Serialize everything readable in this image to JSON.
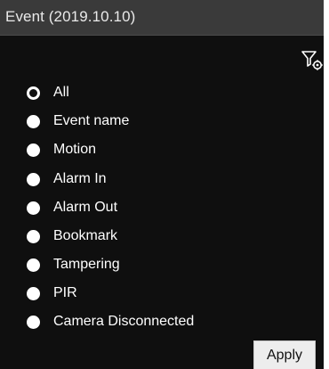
{
  "panel": {
    "title": "Event (2019.10.10)",
    "filter_icon": "filter-settings-icon"
  },
  "event_filter": {
    "selected": "All",
    "options": [
      {
        "label": "All",
        "checked": true
      },
      {
        "label": "Event name",
        "checked": false
      },
      {
        "label": "Motion",
        "checked": false
      },
      {
        "label": "Alarm In",
        "checked": false
      },
      {
        "label": "Alarm Out",
        "checked": false
      },
      {
        "label": "Bookmark",
        "checked": false
      },
      {
        "label": "Tampering",
        "checked": false
      },
      {
        "label": "PIR",
        "checked": false
      },
      {
        "label": "Camera Disconnected",
        "checked": false
      }
    ]
  },
  "footer": {
    "apply_label": "Apply"
  },
  "colors": {
    "panel_background": "#0f0f0f",
    "titlebar_background": "#3a3a3a",
    "text": "#ffffff",
    "button_background": "#ededed"
  }
}
